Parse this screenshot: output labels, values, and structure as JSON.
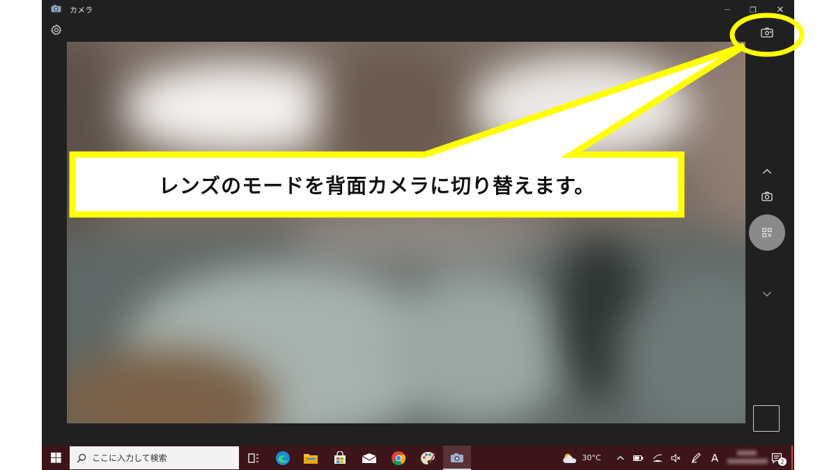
{
  "window": {
    "title": "カメラ",
    "controls": {
      "minimize": "—",
      "restore": "❐",
      "close": "✕"
    }
  },
  "icons": {
    "app": "camera-icon",
    "settings": "gear-icon",
    "switch_camera": "switch-camera-icon",
    "mode_up": "chevron-up-icon",
    "photo_mode": "camera-icon",
    "shutter": "qr-code-icon",
    "mode_down": "chevron-down-icon"
  },
  "callout": {
    "text": "レンズのモードを背面カメラに切り替えます。",
    "color": "#ffff00"
  },
  "taskbar": {
    "search_placeholder": "ここに入力して検索",
    "weather_temp": "30°C",
    "ime_indicator": "A",
    "notification_count": "2",
    "background": "#3d1419"
  }
}
